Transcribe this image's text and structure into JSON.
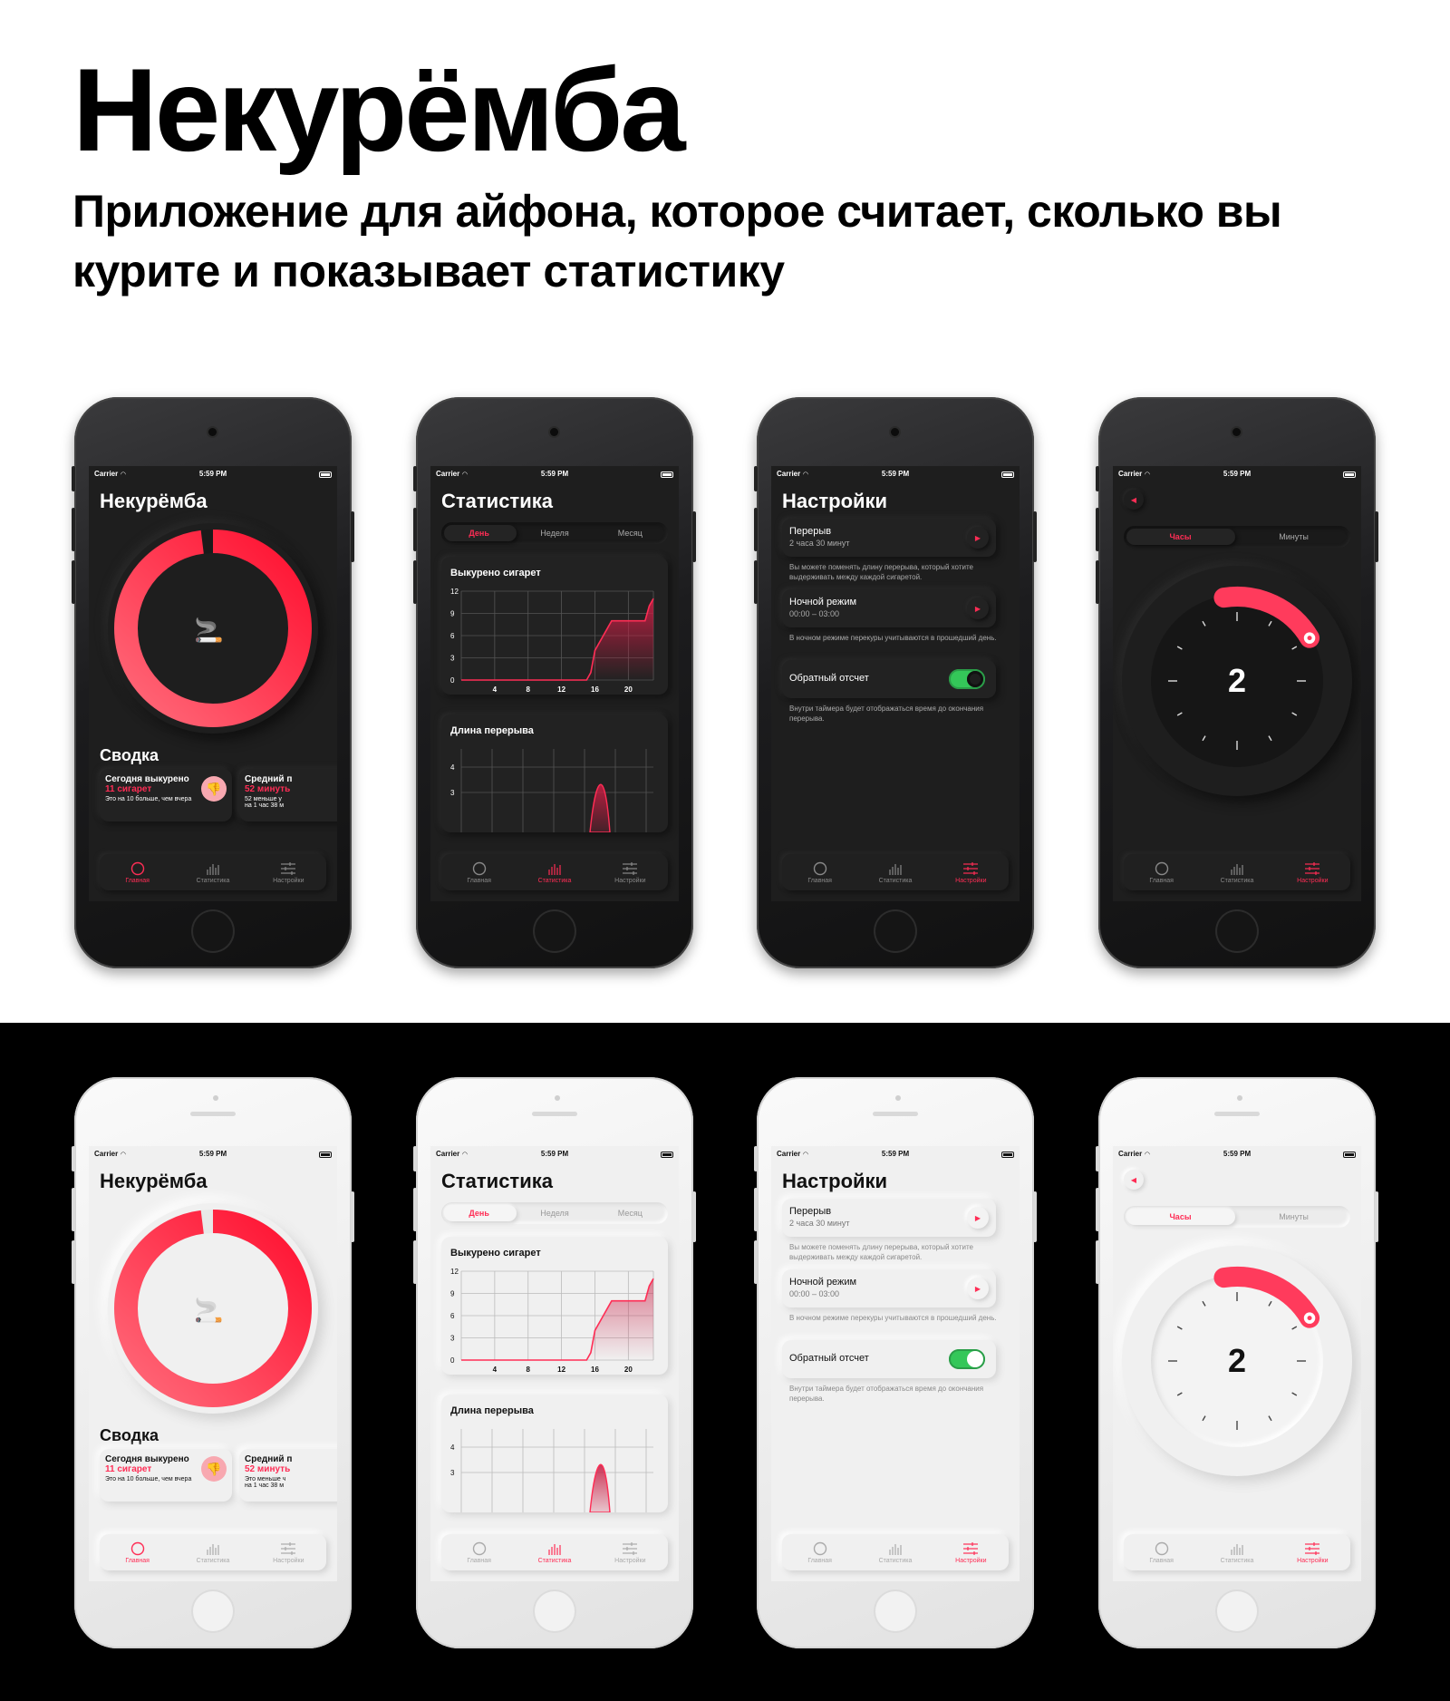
{
  "hero": {
    "title": "Некурёмба",
    "subtitle": "Приложение для айфона, которое считает, сколько вы курите и показывает статистику"
  },
  "colors": {
    "accent": "#ff2d55",
    "toggle_on": "#34c759",
    "dark_bg": "#1e1e1e",
    "light_bg": "#f0f0f0"
  },
  "status": {
    "carrier": "Carrier",
    "time": "5:59 PM"
  },
  "tabs": {
    "home": "Главная",
    "stats": "Статистика",
    "settings": "Настройки"
  },
  "icons": {
    "home": "circle-icon",
    "stats": "bar-chart-icon",
    "settings": "sliders-icon",
    "cigarette": "cigarette-emoji",
    "badge": "thumbs-down-emoji"
  },
  "main": {
    "title": "Некурёмба",
    "progress": 0.98,
    "summary_title": "Сводка",
    "cards": [
      {
        "heading": "Сегодня выкурено",
        "value": "11 сигарет",
        "note": "Это на 10 больше, чем вчера"
      },
      {
        "heading": "Средний п",
        "value": "52 минуть",
        "note_dark": "52 меньше у",
        "note": "на 1 час 38 м"
      }
    ],
    "light_card2_note1": "Это меньше ч",
    "light_card2_note2": "на 1 час 38 м"
  },
  "stats": {
    "title": "Статистика",
    "segments": [
      "День",
      "Неделя",
      "Месяц"
    ],
    "chart1_title": "Выкурено сигарет",
    "chart2_title": "Длина перерыва"
  },
  "chart_data": [
    {
      "type": "area",
      "title": "Выкурено сигарет",
      "x": [
        0,
        2,
        4,
        6,
        8,
        10,
        12,
        14,
        15,
        15.5,
        16,
        17,
        18,
        19,
        20,
        21,
        22,
        22.5,
        23
      ],
      "values": [
        0,
        0,
        0,
        0,
        0,
        0,
        0,
        0,
        0,
        1,
        4,
        6,
        8,
        8,
        8,
        8,
        8,
        10,
        11
      ],
      "xticks": [
        4,
        8,
        12,
        16,
        20
      ],
      "yticks": [
        0,
        3,
        6,
        9,
        12
      ],
      "ylim": [
        0,
        12
      ],
      "xlim": [
        0,
        23
      ]
    },
    {
      "type": "area",
      "title": "Длина перерыва",
      "yticks": [
        3,
        4
      ]
    }
  ],
  "settings": {
    "title": "Настройки",
    "break_label": "Перерыв",
    "break_value": "2 часа 30 минут",
    "break_note": "Вы можете поменять длину перерыва, который хотите выдерживать между каждой сигаретой.",
    "night_label": "Ночной режим",
    "night_value": "00:00 – 03:00",
    "night_note": "В ночном режиме перекуры учитываются в прошедший день.",
    "countdown_label": "Обратный отсчет",
    "countdown_note": "Внутри таймера будет отображаться время до окончания перерыва."
  },
  "timer": {
    "segments": [
      "Часы",
      "Минуты"
    ],
    "value": "2"
  }
}
